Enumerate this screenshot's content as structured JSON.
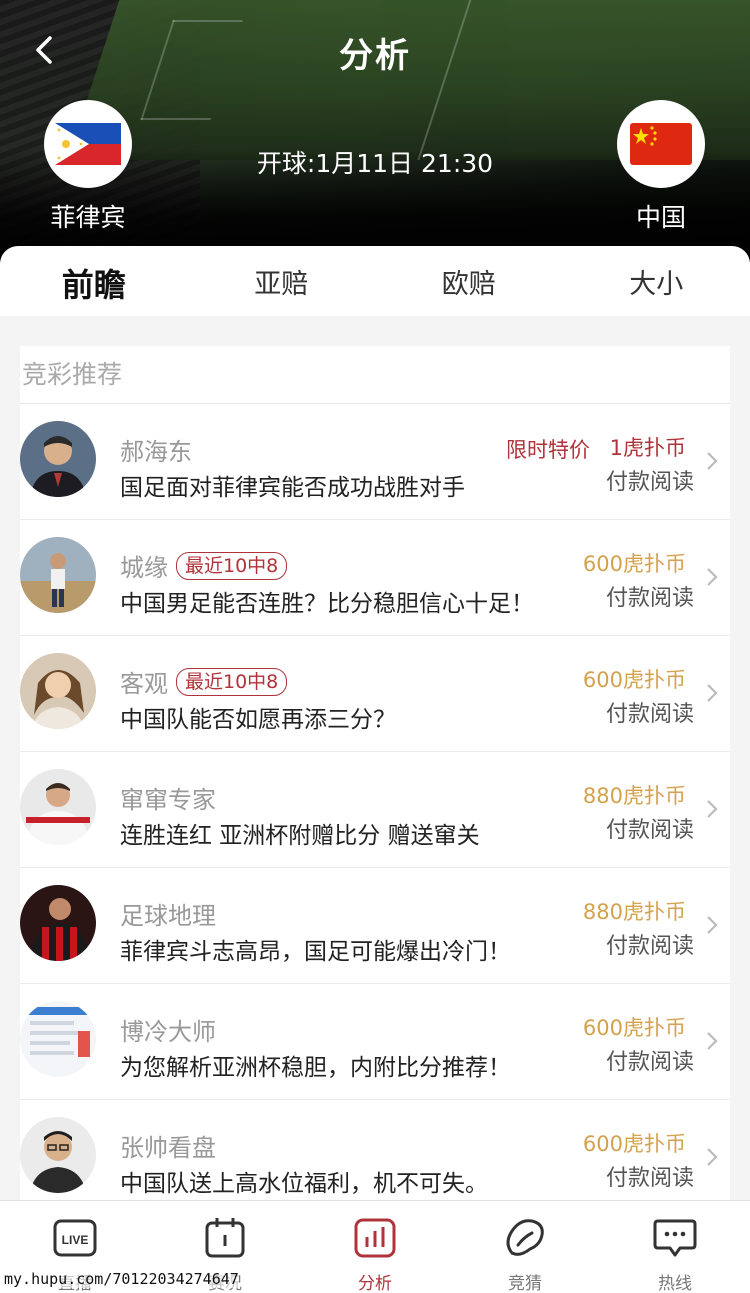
{
  "header": {
    "title": "分析",
    "kickoff": "开球:1月11日  21:30",
    "home_team": {
      "name": "菲律宾",
      "flag": "philippines-flag"
    },
    "away_team": {
      "name": "中国",
      "flag": "china-flag"
    }
  },
  "tabs": [
    {
      "label": "前瞻",
      "active": true
    },
    {
      "label": "亚赔",
      "active": false
    },
    {
      "label": "欧赔",
      "active": false
    },
    {
      "label": "大小",
      "active": false
    }
  ],
  "section": {
    "title": "竞彩推荐",
    "items": [
      {
        "author": "郝海东",
        "badge": "",
        "promo": "限时特价",
        "title": "国足面对菲律宾能否成功战胜对手",
        "price": "1虎扑币",
        "action": "付款阅读",
        "price_color": "#b0333b"
      },
      {
        "author": "城缘",
        "badge": "最近10中8",
        "promo": "",
        "title": "中国男足能否连胜？比分稳胆信心十足！",
        "price": "600虎扑币",
        "action": "付款阅读",
        "price_color": "#d4a24c"
      },
      {
        "author": "客观",
        "badge": "最近10中8",
        "promo": "",
        "title": "中国队能否如愿再添三分？",
        "price": "600虎扑币",
        "action": "付款阅读",
        "price_color": "#d4a24c"
      },
      {
        "author": "窜窜专家",
        "badge": "",
        "promo": "",
        "title": "连胜连红 亚洲杯附赠比分 赠送窜关",
        "price": "880虎扑币",
        "action": "付款阅读",
        "price_color": "#d4a24c"
      },
      {
        "author": "足球地理",
        "badge": "",
        "promo": "",
        "title": "菲律宾斗志高昂，国足可能爆出冷门！",
        "price": "880虎扑币",
        "action": "付款阅读",
        "price_color": "#d4a24c"
      },
      {
        "author": "博冷大师",
        "badge": "",
        "promo": "",
        "title": "为您解析亚洲杯稳胆，内附比分推荐！",
        "price": "600虎扑币",
        "action": "付款阅读",
        "price_color": "#d4a24c"
      },
      {
        "author": "张帅看盘",
        "badge": "",
        "promo": "",
        "title": "中国队送上高水位福利，机不可失。",
        "price": "600虎扑币",
        "action": "付款阅读",
        "price_color": "#d4a24c"
      }
    ]
  },
  "bottom_nav": [
    {
      "label": "直播",
      "icon": "live-icon",
      "active": false
    },
    {
      "label": "赛况",
      "icon": "calendar-icon",
      "active": false
    },
    {
      "label": "分析",
      "icon": "bar-chart-icon",
      "active": true
    },
    {
      "label": "竞猜",
      "icon": "bean-icon",
      "active": false
    },
    {
      "label": "热线",
      "icon": "chat-bubble-icon",
      "active": false
    }
  ],
  "watermark": "my.hupu.com/70122034274647",
  "colors": {
    "accent": "#b0333b",
    "price_gold": "#d4a24c"
  }
}
